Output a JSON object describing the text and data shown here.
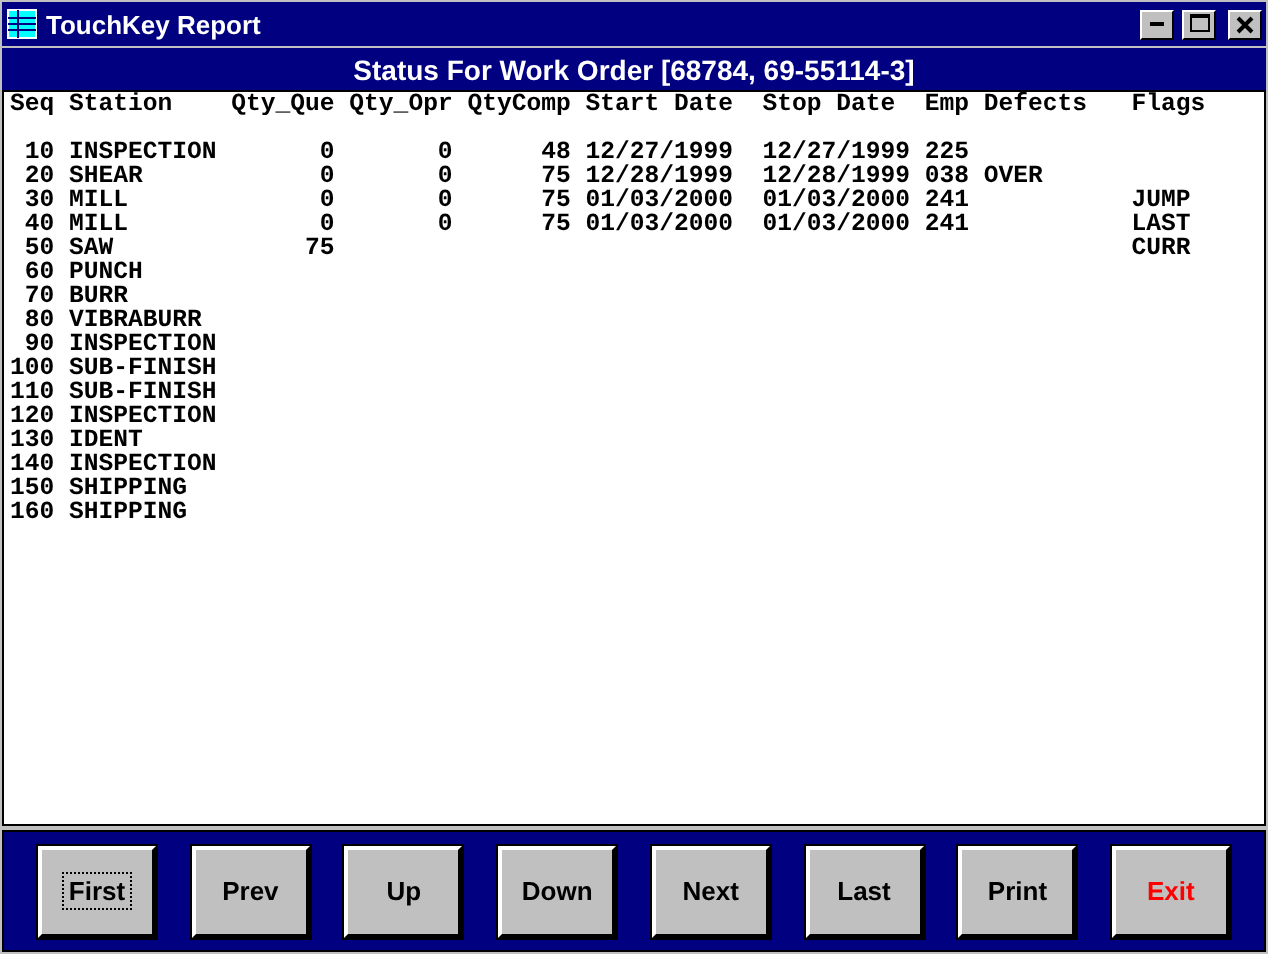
{
  "window": {
    "title": "TouchKey Report"
  },
  "header": {
    "title": "Status For Work Order [68784, 69-55114-3]"
  },
  "table": {
    "columns": [
      "Seq",
      "Station",
      "Qty_Que",
      "Qty_Opr",
      "QtyComp",
      "Start Date",
      "Stop Date",
      "Emp",
      "Defects",
      "Flags"
    ],
    "rows": [
      {
        "seq": "10",
        "station": "INSPECTION",
        "qty_que": "0",
        "qty_opr": "0",
        "qty_comp": "48",
        "start": "12/27/1999",
        "stop": "12/27/1999",
        "emp": "225"
      },
      {
        "seq": "20",
        "station": "SHEAR",
        "qty_que": "0",
        "qty_opr": "0",
        "qty_comp": "75",
        "start": "12/28/1999",
        "stop": "12/28/1999",
        "emp": "038",
        "defects": "OVER"
      },
      {
        "seq": "30",
        "station": "MILL",
        "qty_que": "0",
        "qty_opr": "0",
        "qty_comp": "75",
        "start": "01/03/2000",
        "stop": "01/03/2000",
        "emp": "241",
        "flags": "JUMP"
      },
      {
        "seq": "40",
        "station": "MILL",
        "qty_que": "0",
        "qty_opr": "0",
        "qty_comp": "75",
        "start": "01/03/2000",
        "stop": "01/03/2000",
        "emp": "241",
        "flags": "LAST"
      },
      {
        "seq": "50",
        "station": "SAW",
        "qty_que": "75",
        "flags": "CURR"
      },
      {
        "seq": "60",
        "station": "PUNCH"
      },
      {
        "seq": "70",
        "station": "BURR"
      },
      {
        "seq": "80",
        "station": "VIBRABURR"
      },
      {
        "seq": "90",
        "station": "INSPECTION"
      },
      {
        "seq": "100",
        "station": "SUB-FINISH"
      },
      {
        "seq": "110",
        "station": "SUB-FINISH"
      },
      {
        "seq": "120",
        "station": "INSPECTION"
      },
      {
        "seq": "130",
        "station": "IDENT"
      },
      {
        "seq": "140",
        "station": "INSPECTION"
      },
      {
        "seq": "150",
        "station": "SHIPPING"
      },
      {
        "seq": "160",
        "station": "SHIPPING"
      }
    ]
  },
  "buttons": [
    {
      "label": "First",
      "focused": true,
      "color": "#000000"
    },
    {
      "label": "Prev",
      "focused": false,
      "color": "#000000"
    },
    {
      "label": "Up",
      "focused": false,
      "color": "#000000"
    },
    {
      "label": "Down",
      "focused": false,
      "color": "#000000"
    },
    {
      "label": "Next",
      "focused": false,
      "color": "#000000"
    },
    {
      "label": "Last",
      "focused": false,
      "color": "#000000"
    },
    {
      "label": "Print",
      "focused": false,
      "color": "#000000"
    },
    {
      "label": "Exit",
      "focused": false,
      "color": "#ff0000"
    }
  ]
}
